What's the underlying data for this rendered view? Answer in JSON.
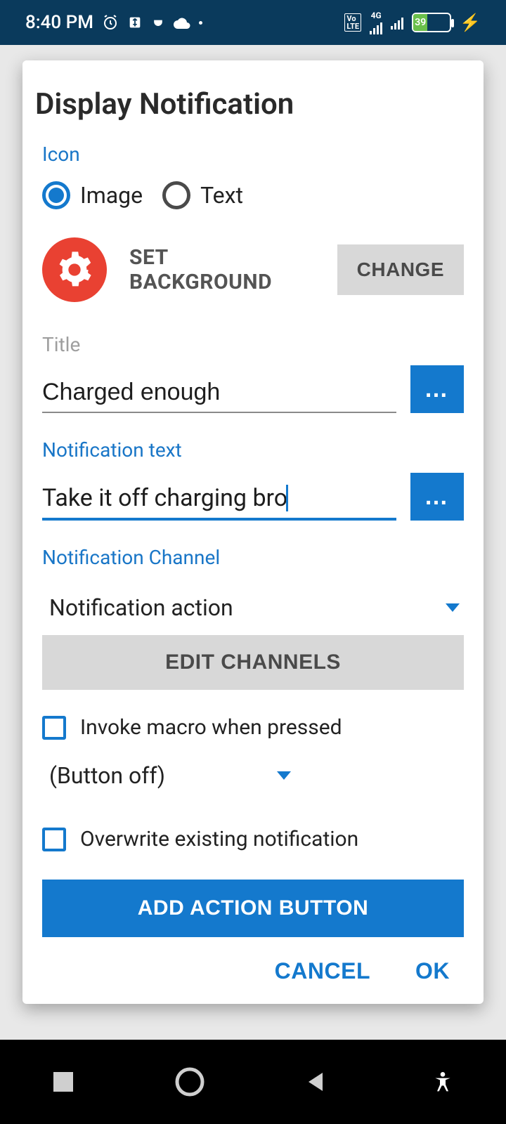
{
  "statusbar": {
    "time": "8:40 PM",
    "battery_pct": "39"
  },
  "dialog": {
    "title": "Display Notification",
    "icon_section": "Icon",
    "radio_image": "Image",
    "radio_text": "Text",
    "set_bg": "SET BACKGROUND",
    "change_btn": "CHANGE",
    "title_label": "Title",
    "title_value": "Charged enough",
    "notif_text_label": "Notification text",
    "notif_text_value": "Take it off charging bro",
    "channel_label": "Notification Channel",
    "channel_value": "Notification action",
    "edit_channels": "EDIT CHANNELS",
    "invoke_macro": "Invoke macro when pressed",
    "button_off": "(Button off)",
    "overwrite": "Overwrite existing notification",
    "add_action": "ADD ACTION BUTTON",
    "cancel": "CANCEL",
    "ok": "OK",
    "more": "…"
  }
}
